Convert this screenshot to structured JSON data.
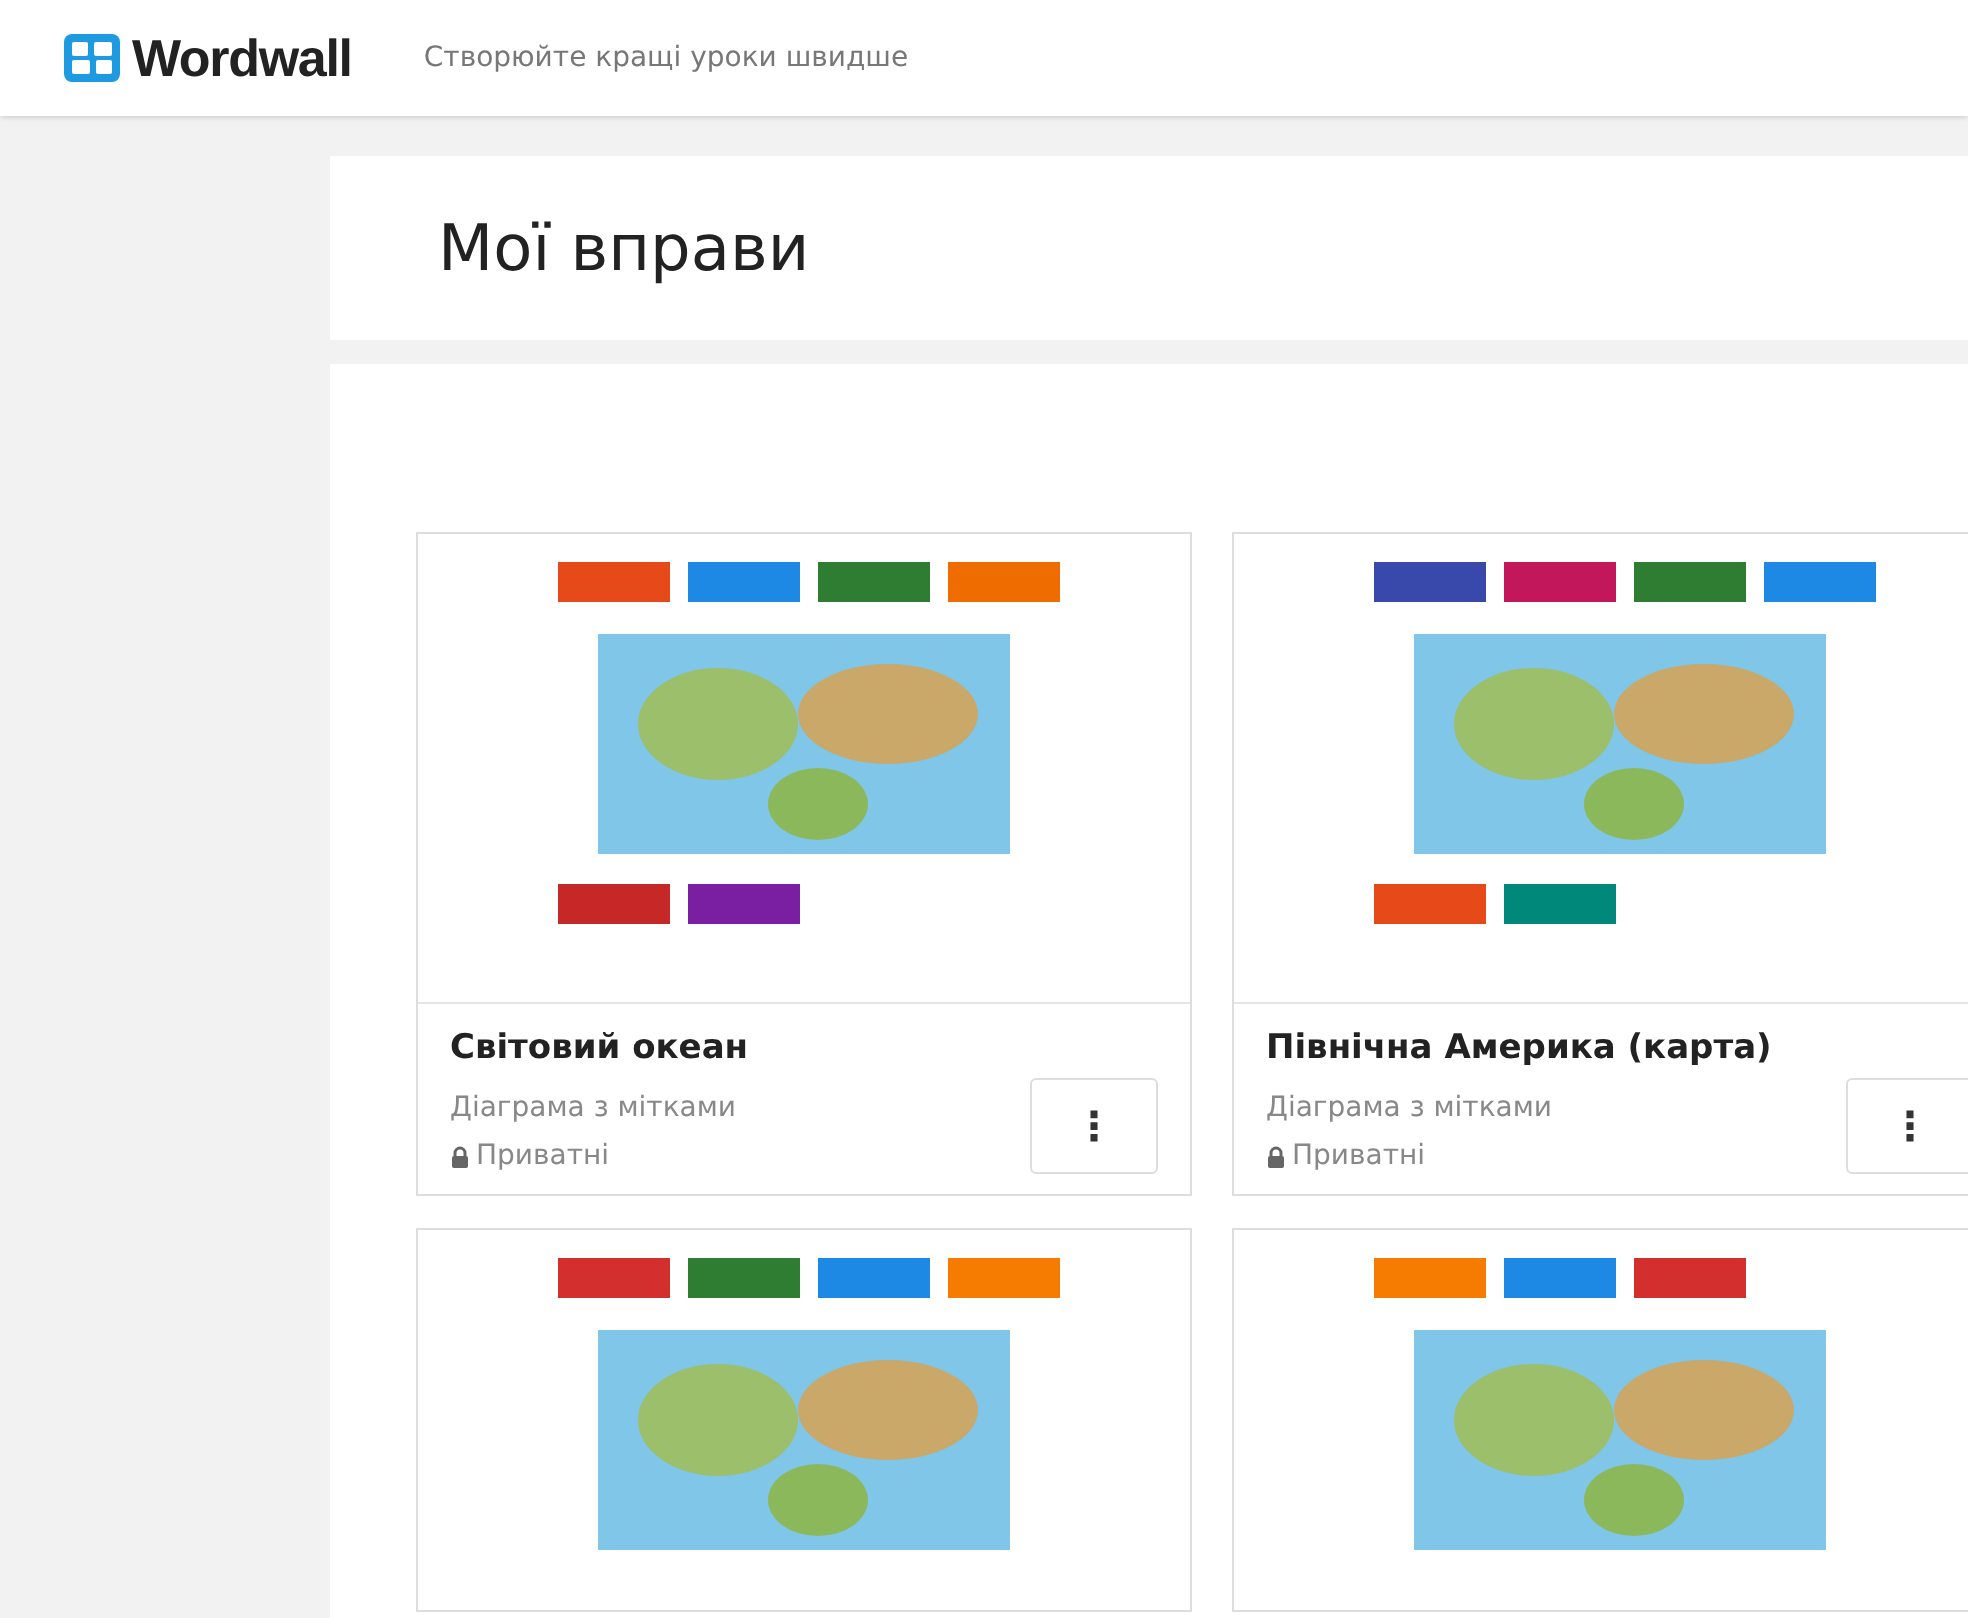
{
  "header": {
    "logo": "Wordwall",
    "tagline": "Створюйте кращі уроки швидше"
  },
  "page_title": "Мої вправи",
  "cards": [
    {
      "kind": "full",
      "title": "Світовий океан",
      "type": "Діаграма з мітками",
      "privacy": "Приватні",
      "menu": "⋮"
    },
    {
      "kind": "full",
      "title": "Північна Америка (карта)",
      "type": "Діаграма з мітками",
      "privacy": "Приватні",
      "menu": "⋮"
    },
    {
      "kind": "image_only"
    },
    {
      "kind": "image_only"
    }
  ]
}
